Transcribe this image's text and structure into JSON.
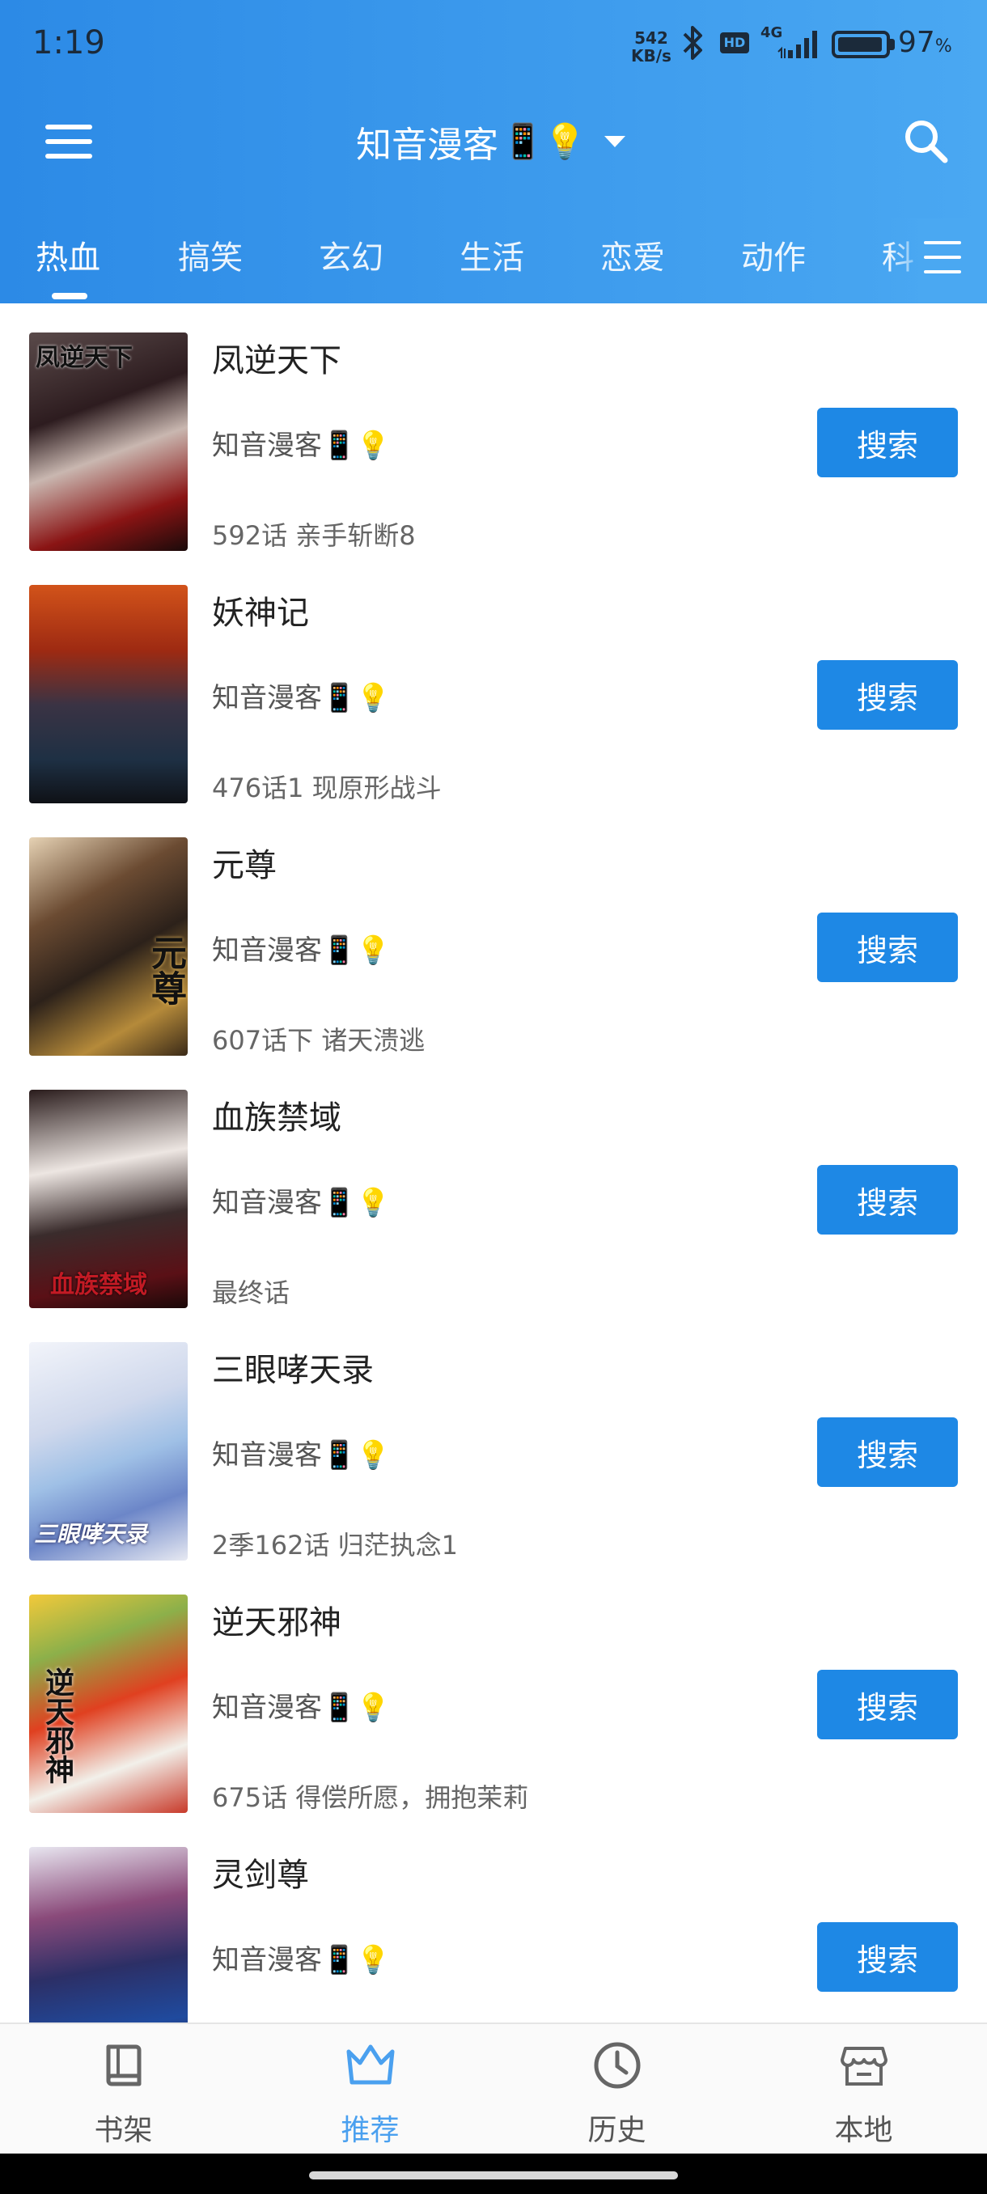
{
  "status_bar": {
    "time": "1:19",
    "speed_value": "542",
    "speed_unit": "KB/s",
    "hd_label": "HD",
    "network": "4G",
    "battery_percent": "97",
    "battery_symbol": "%",
    "battery_level": 0.97
  },
  "app_bar": {
    "title": "知音漫客",
    "title_emoji": "📱💡"
  },
  "tabs": [
    {
      "label": "热血",
      "active": true
    },
    {
      "label": "搞笑",
      "active": false
    },
    {
      "label": "玄幻",
      "active": false
    },
    {
      "label": "生活",
      "active": false
    },
    {
      "label": "恋爱",
      "active": false
    },
    {
      "label": "动作",
      "active": false
    },
    {
      "label": "科",
      "active": false
    }
  ],
  "items": [
    {
      "title": "凤逆天下",
      "source": "知音漫客📱💡",
      "chapter": "592话 亲手斩断8",
      "button": "搜索",
      "cover_text": "凤逆天下"
    },
    {
      "title": "妖神记",
      "source": "知音漫客📱💡",
      "chapter": "476话1 现原形战斗",
      "button": "搜索",
      "cover_text": ""
    },
    {
      "title": "元尊",
      "source": "知音漫客📱💡",
      "chapter": "607话下 诸天溃逃",
      "button": "搜索",
      "cover_text": "元尊"
    },
    {
      "title": "血族禁域",
      "source": "知音漫客📱💡",
      "chapter": "最终话",
      "button": "搜索",
      "cover_text": "血族禁域"
    },
    {
      "title": "三眼哮天录",
      "source": "知音漫客📱💡",
      "chapter": "2季162话 归茫执念1",
      "button": "搜索",
      "cover_text": "三眼哮天录"
    },
    {
      "title": "逆天邪神",
      "source": "知音漫客📱💡",
      "chapter": "675话 得偿所愿，拥抱茉莉",
      "button": "搜索",
      "cover_text": "逆天邪神"
    },
    {
      "title": "灵剑尊",
      "source": "知音漫客📱💡",
      "chapter": "",
      "button": "搜索",
      "cover_text": ""
    }
  ],
  "bottom_nav": [
    {
      "label": "书架",
      "icon": "book-icon",
      "active": false
    },
    {
      "label": "推荐",
      "icon": "crown-icon",
      "active": true
    },
    {
      "label": "历史",
      "icon": "clock-icon",
      "active": false
    },
    {
      "label": "本地",
      "icon": "store-icon",
      "active": false
    }
  ],
  "colors": {
    "header_start": "#2c8ae6",
    "header_end": "#4aa8f2",
    "button": "#1e88e5",
    "nav_active": "#4aa0ef"
  }
}
